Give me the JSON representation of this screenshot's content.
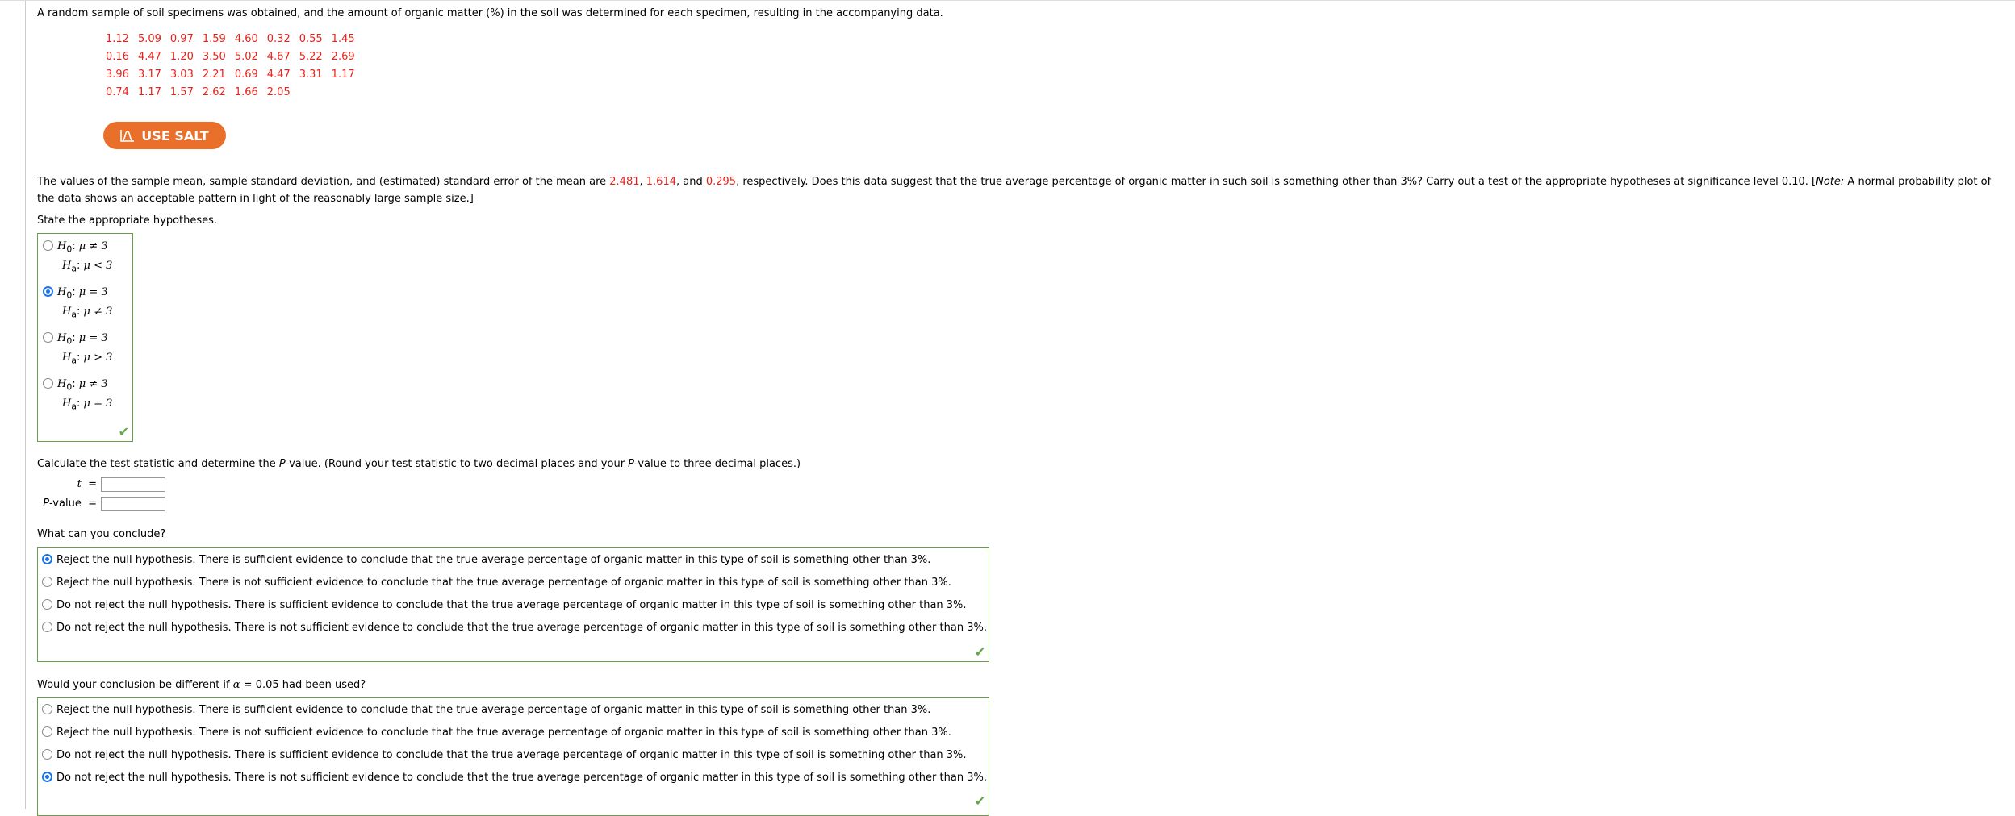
{
  "intro": "A random sample of soil specimens was obtained, and the amount of organic matter (%) in the soil was determined for each specimen, resulting in the accompanying data.",
  "data_rows": [
    [
      "1.12",
      "5.09",
      "0.97",
      "1.59",
      "4.60",
      "0.32",
      "0.55",
      "1.45"
    ],
    [
      "0.16",
      "4.47",
      "1.20",
      "3.50",
      "5.02",
      "4.67",
      "5.22",
      "2.69"
    ],
    [
      "3.96",
      "3.17",
      "3.03",
      "2.21",
      "0.69",
      "4.47",
      "3.31",
      "1.17"
    ],
    [
      "0.74",
      "1.17",
      "1.57",
      "2.62",
      "1.66",
      "2.05"
    ]
  ],
  "salt_button": {
    "label": "USE SALT",
    "color": "#e8702a"
  },
  "stats": {
    "pre": "The values of the sample mean, sample standard deviation, and (estimated) standard error of the mean are ",
    "mean": "2.481",
    "sep1": ", ",
    "sd": "1.614",
    "sep2": ", and ",
    "se": "0.295",
    "post": ", respectively. Does this data suggest that the true average percentage of organic matter in such soil is something other than 3%? Carry out a test of the appropriate hypotheses at significance level 0.10. [",
    "note_label": "Note:",
    "note": " A normal probability plot of the data shows an acceptable pattern in light of the reasonably large sample size.]"
  },
  "hypotheses": {
    "prompt": "State the appropriate hypotheses.",
    "options": [
      {
        "h0": "μ ≠ 3",
        "ha": "μ < 3",
        "checked": false
      },
      {
        "h0": "μ = 3",
        "ha": "μ ≠ 3",
        "checked": true
      },
      {
        "h0": "μ = 3",
        "ha": "μ > 3",
        "checked": false
      },
      {
        "h0": "μ ≠ 3",
        "ha": "μ = 3",
        "checked": false
      }
    ]
  },
  "calc": {
    "prompt_pre": "Calculate the test statistic and determine the ",
    "p_italic": "P",
    "prompt_mid": "-value. (Round your test statistic to two decimal places and your ",
    "p_italic2": "P",
    "prompt_post": "-value to three decimal places.)",
    "t_label": "t",
    "p_label": "P",
    "p_label_rest": "-value",
    "equals": "=",
    "t_value": "",
    "p_value": ""
  },
  "conclude": {
    "prompt": "What can you conclude?",
    "options": [
      {
        "text": "Reject the null hypothesis. There is sufficient evidence to conclude that the true average percentage of organic matter in this type of soil is something other than 3%.",
        "checked": true
      },
      {
        "text": "Reject the null hypothesis. There is not sufficient evidence to conclude that the true average percentage of organic matter in this type of soil is something other than 3%.",
        "checked": false
      },
      {
        "text": "Do not reject the null hypothesis. There is sufficient evidence to conclude that the true average percentage of organic matter in this type of soil is something other than 3%.",
        "checked": false
      },
      {
        "text": "Do not reject the null hypothesis. There is not sufficient evidence to conclude that the true average percentage of organic matter in this type of soil is something other than 3%.",
        "checked": false
      }
    ]
  },
  "alpha": {
    "prompt_pre": "Would your conclusion be different if ",
    "alpha_symbol": "α",
    "prompt_post": " = 0.05 had been used?",
    "options": [
      {
        "text": "Reject the null hypothesis. There is sufficient evidence to conclude that the true average percentage of organic matter in this type of soil is something other than 3%.",
        "checked": false
      },
      {
        "text": "Reject the null hypothesis. There is not sufficient evidence to conclude that the true average percentage of organic matter in this type of soil is something other than 3%.",
        "checked": false
      },
      {
        "text": "Do not reject the null hypothesis. There is sufficient evidence to conclude that the true average percentage of organic matter in this type of soil is something other than 3%.",
        "checked": false
      },
      {
        "text": "Do not reject the null hypothesis. There is not sufficient evidence to conclude that the true average percentage of organic matter in this type of soil is something other than 3%.",
        "checked": true
      }
    ]
  },
  "correct_mark": "✔"
}
